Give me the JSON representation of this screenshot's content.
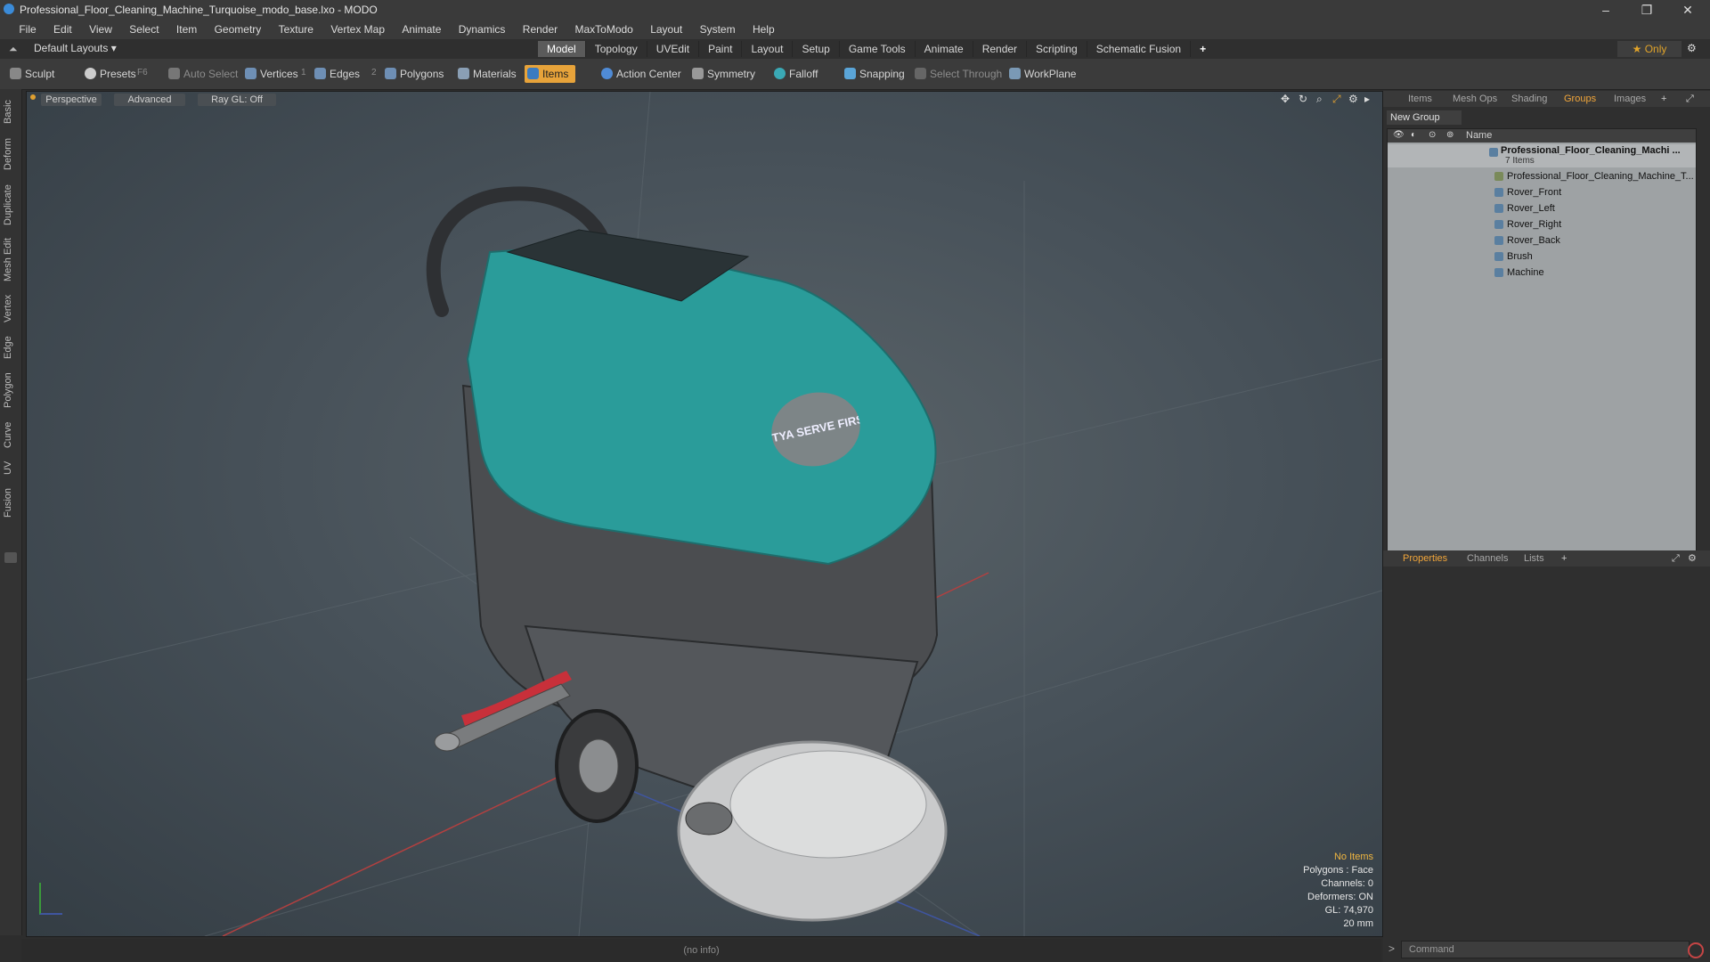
{
  "window": {
    "title": "Professional_Floor_Cleaning_Machine_Turquoise_modo_base.lxo - MODO"
  },
  "menu": [
    "File",
    "Edit",
    "View",
    "Select",
    "Item",
    "Geometry",
    "Texture",
    "Vertex Map",
    "Animate",
    "Dynamics",
    "Render",
    "MaxToModo",
    "Layout",
    "System",
    "Help"
  ],
  "layouts": {
    "label": "Default Layouts ▾"
  },
  "tabs": [
    "Model",
    "Topology",
    "UVEdit",
    "Paint",
    "Layout",
    "Setup",
    "Game Tools",
    "Animate",
    "Render",
    "Scripting",
    "Schematic Fusion"
  ],
  "only_label": "★  Only",
  "toolbar": {
    "sculpt": "Sculpt",
    "presets": "Presets",
    "presets_key": "F6",
    "auto_select": "Auto Select",
    "vertices": "Vertices",
    "vertices_key": "1",
    "edges": "Edges",
    "edges_key": "2",
    "polygons": "Polygons",
    "materials": "Materials",
    "items": "Items",
    "action_center": "Action Center",
    "symmetry": "Symmetry",
    "falloff": "Falloff",
    "snapping": "Snapping",
    "select_through": "Select Through",
    "workplane": "WorkPlane"
  },
  "left_tabs": [
    "Basic",
    "Deform",
    "Duplicate",
    "Mesh Edit",
    "Vertex",
    "Edge",
    "Polygon",
    "Curve",
    "UV",
    "Fusion"
  ],
  "viewport": {
    "perspective": "Perspective",
    "advanced": "Advanced",
    "raygl": "Ray GL: Off",
    "logo_text": "TYA SERVE FIRST",
    "info": {
      "items": "No Items",
      "polygons": "Polygons : Face",
      "channels": "Channels: 0",
      "deformers": "Deformers: ON",
      "gl": "GL: 74,970",
      "scale": "20 mm"
    }
  },
  "status": "(no info)",
  "right_panel": {
    "tabs": [
      "Items",
      "Mesh Ops",
      "Shading",
      "Groups",
      "Images"
    ],
    "new_group": "New Group",
    "col_name": "Name",
    "root": {
      "label": "Professional_Floor_Cleaning_Machi ...",
      "count": "7 Items"
    },
    "items": [
      "Professional_Floor_Cleaning_Machine_T...",
      "Rover_Front",
      "Rover_Left",
      "Rover_Right",
      "Rover_Back",
      "Brush",
      "Machine"
    ],
    "lower_tabs": [
      "Properties",
      "Channels",
      "Lists"
    ],
    "command_placeholder": "Command"
  },
  "colors": {
    "accent": "#f0a53a",
    "teal_body": "#2a9c9a",
    "viewport_bg": "#48525a"
  }
}
